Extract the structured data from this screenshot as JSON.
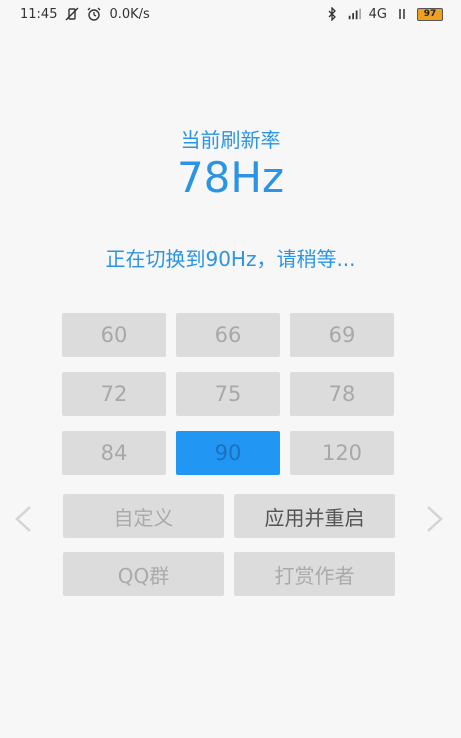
{
  "status_bar": {
    "time": "11:45",
    "speed": "0.0K/s",
    "network": "4G",
    "battery": "97"
  },
  "header": {
    "title": "当前刷新率",
    "current_rate": "78Hz",
    "status": "正在切换到90Hz，请稍等..."
  },
  "rates": [
    {
      "label": "60"
    },
    {
      "label": "66"
    },
    {
      "label": "69"
    },
    {
      "label": "72"
    },
    {
      "label": "75"
    },
    {
      "label": "78"
    },
    {
      "label": "84"
    },
    {
      "label": "90",
      "selected": true
    },
    {
      "label": "120"
    }
  ],
  "actions": {
    "custom": "自定义",
    "apply_restart": "应用并重启",
    "qq_group": "QQ群",
    "donate": "打赏作者"
  },
  "colors": {
    "accent": "#2b95e3",
    "selected": "#2196f3",
    "button_bg": "#dcdcdc"
  }
}
